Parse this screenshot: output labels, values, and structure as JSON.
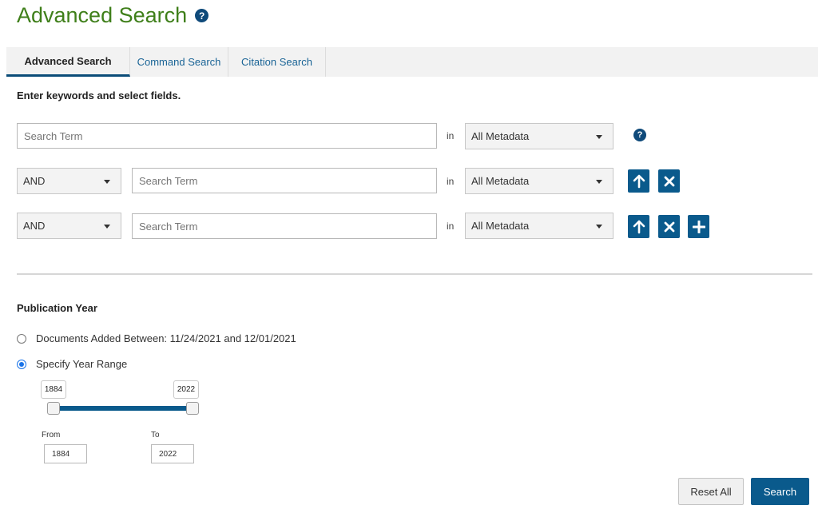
{
  "page_title": "Advanced Search",
  "tabs": [
    {
      "label": "Advanced Search"
    },
    {
      "label": "Command Search"
    },
    {
      "label": "Citation Search"
    }
  ],
  "instructions": "Enter keywords and select fields.",
  "rows": [
    {
      "placeholder": "Search Term",
      "in": "in",
      "field": "All Metadata"
    },
    {
      "operator": "AND",
      "placeholder": "Search Term",
      "in": "in",
      "field": "All Metadata"
    },
    {
      "operator": "AND",
      "placeholder": "Search Term",
      "in": "in",
      "field": "All Metadata"
    }
  ],
  "publication_year": {
    "heading": "Publication Year",
    "option_added": "Documents Added Between: 11/24/2021 and 12/01/2021",
    "option_range": "Specify Year Range",
    "selected": "Specify Year Range",
    "slider_min": "1884",
    "slider_max": "2022",
    "from_label": "From",
    "to_label": "To",
    "from_value": "1884",
    "to_value": "2022"
  },
  "buttons": {
    "reset": "Reset All",
    "search": "Search"
  },
  "colors": {
    "title": "#3f7f1a",
    "primary": "#0a5a8c",
    "link": "#1a6496"
  }
}
